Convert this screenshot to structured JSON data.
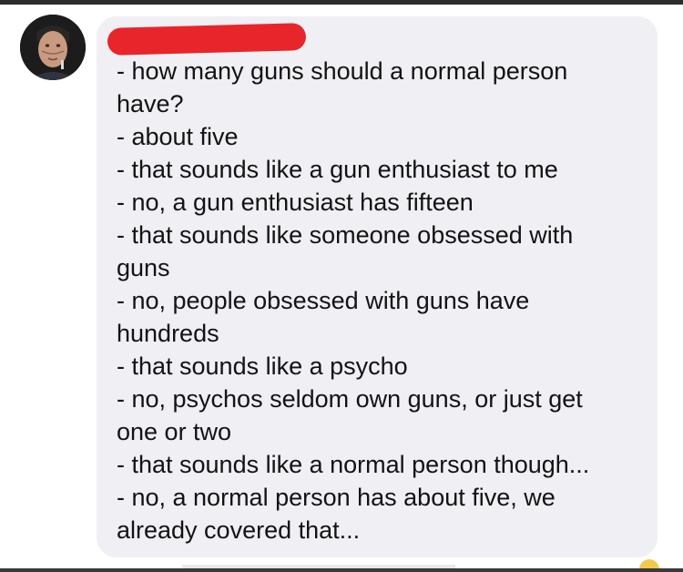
{
  "post": {
    "author_redacted": true,
    "redaction_color": "#e8252a",
    "bubble_color": "#efeff4",
    "lines": [
      "- how many guns should a normal person",
      "have?",
      "- about five",
      "- that sounds like a gun enthusiast to me",
      "- no, a gun enthusiast has fifteen",
      "- that sounds like someone obsessed with",
      "guns",
      "- no, people obsessed with guns have",
      "hundreds",
      "- that sounds like a psycho",
      "- no, psychos seldom own guns, or just get",
      "one or two",
      "- that sounds like a normal person though...",
      "- no, a normal person has about five, we",
      "already covered that..."
    ]
  },
  "icons": {
    "avatar": "profile-photo",
    "reaction": "laugh-reaction-icon"
  }
}
